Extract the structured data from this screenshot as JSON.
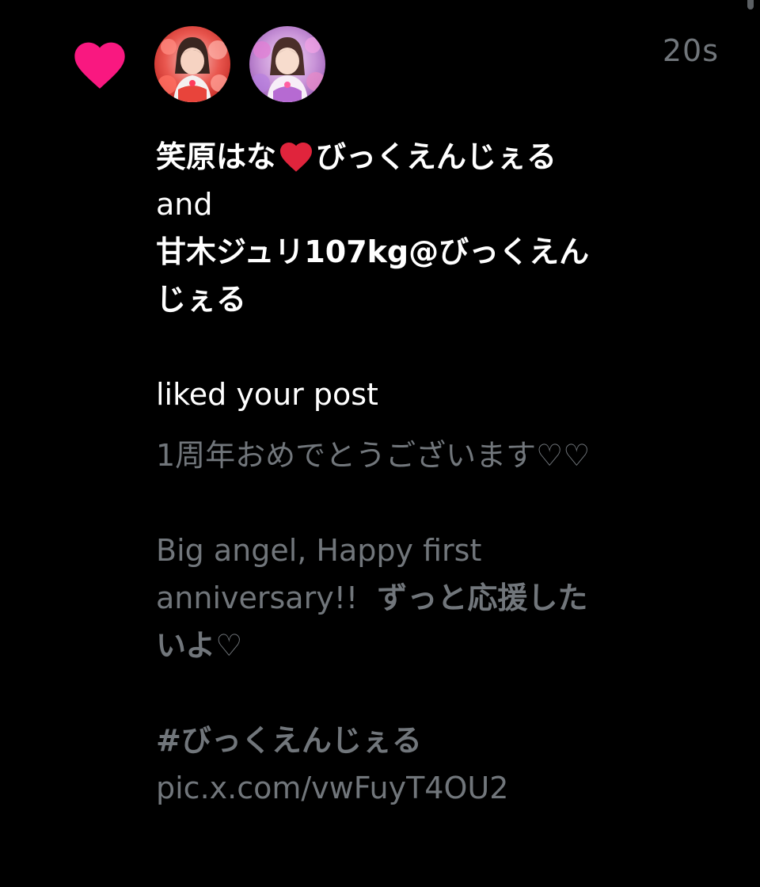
{
  "notification": {
    "type_icon": "heart-icon",
    "timestamp": "20s",
    "avatars": [
      "avatar-1",
      "avatar-2"
    ],
    "user1": {
      "name_prefix": "笑原はな",
      "name_suffix": "びっくえんじぇる"
    },
    "connector": "and",
    "user2": {
      "name": "甘木ジュリ107kg@びっくえんじぇる"
    },
    "action": "liked your post",
    "post": {
      "line1": "1周年おめでとうございます♡♡",
      "line2_regular": "Big angel, Happy first anniversary!!",
      "line2_bold": "ずっと応援したいよ♡",
      "hashtag": "#びっくえんじぇる",
      "link": "pic.x.com/vwFuyT4OU2"
    }
  },
  "colors": {
    "background": "#000000",
    "heart": "#f91880",
    "primary_text": "#ffffff",
    "secondary_text": "#71767b",
    "inline_heart": "#e0243c"
  }
}
